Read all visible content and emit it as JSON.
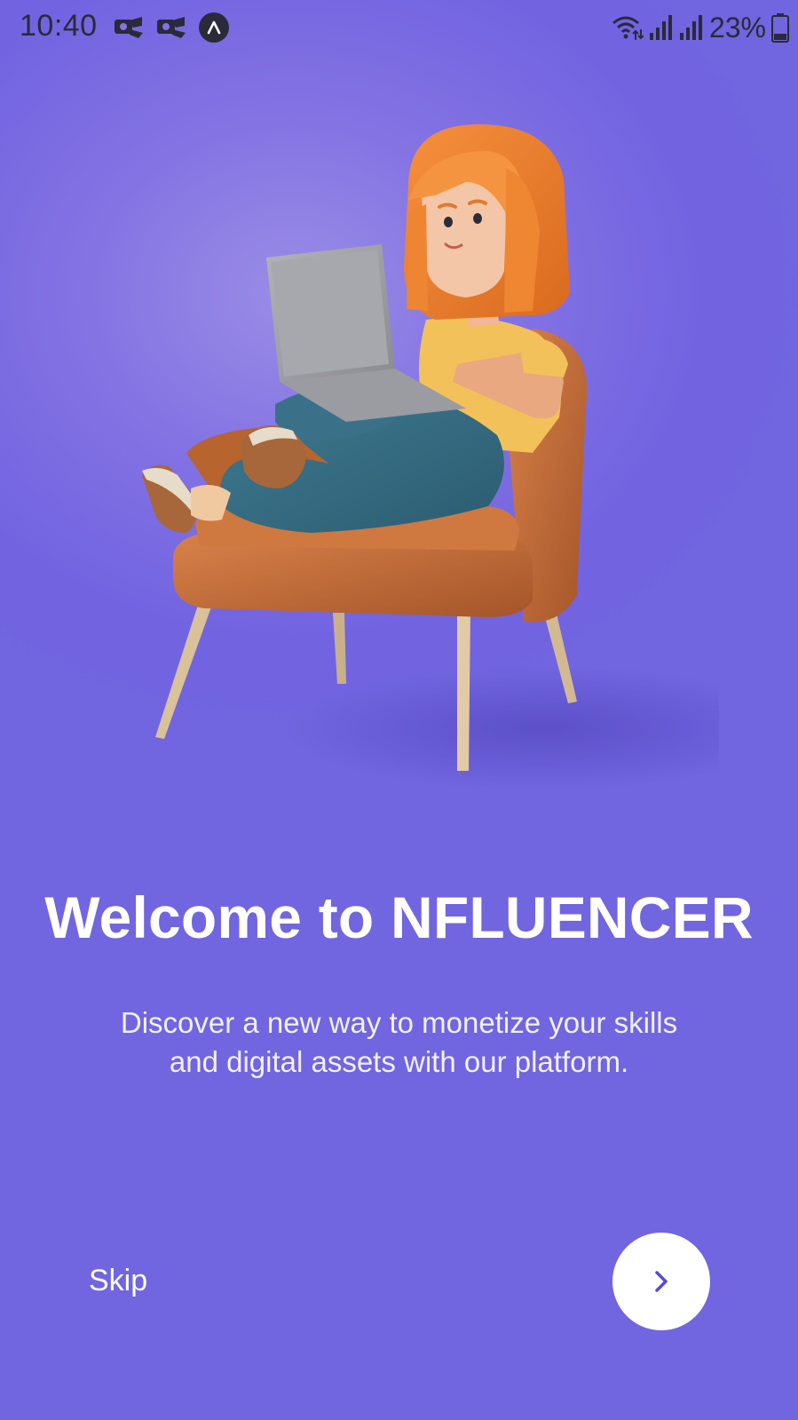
{
  "status_bar": {
    "time": "10:40",
    "battery_percent": "23%",
    "icons": [
      "notification-icon",
      "notification-icon",
      "navigation-app-icon",
      "wifi-icon",
      "signal-icon",
      "signal-icon",
      "battery-icon"
    ]
  },
  "onboarding": {
    "title": "Welcome to NFLUENCER",
    "subtitle_line1": "Discover a new way to monetize your skills",
    "subtitle_line2": "and digital assets with our platform.",
    "illustration": "woman-with-laptop-in-armchair-illustration"
  },
  "actions": {
    "skip_label": "Skip",
    "next_icon": "chevron-right-icon"
  },
  "colors": {
    "background": "#7165e0",
    "accent": "#5a4ad6",
    "text": "#ffffff"
  }
}
